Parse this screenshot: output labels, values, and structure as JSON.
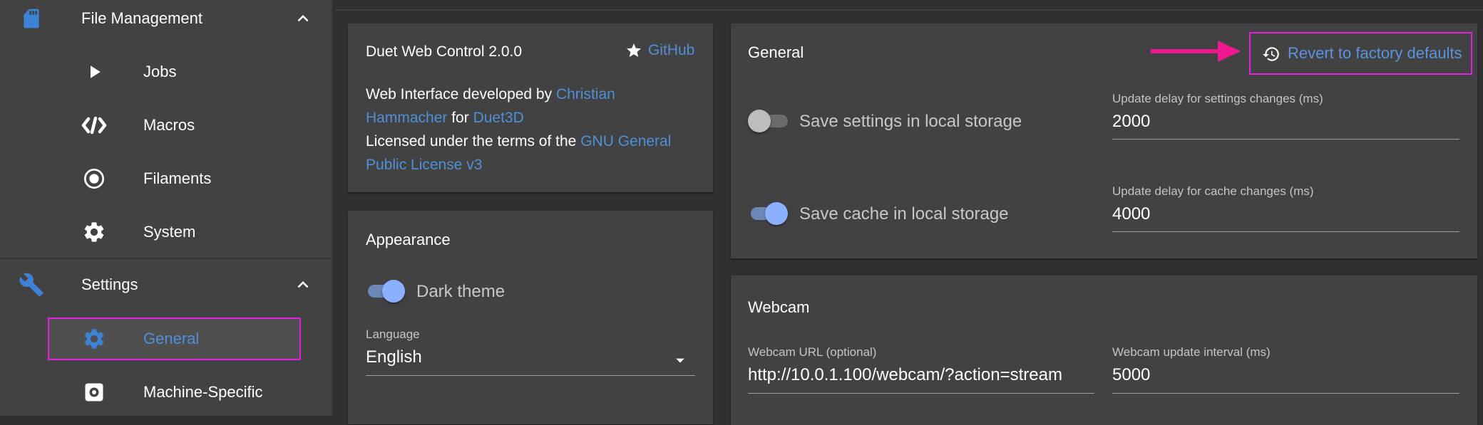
{
  "sidebar": {
    "file_management": {
      "label": "File Management",
      "icon": "sd-card-icon"
    },
    "items_top": [
      {
        "label": "Jobs",
        "icon": "play-icon"
      },
      {
        "label": "Macros",
        "icon": "code-icon"
      },
      {
        "label": "Filaments",
        "icon": "radio-icon"
      },
      {
        "label": "System",
        "icon": "gear-icon"
      }
    ],
    "settings": {
      "label": "Settings",
      "icon": "wrench-icon"
    },
    "items_settings": [
      {
        "label": "General",
        "icon": "gear-icon",
        "active": true
      },
      {
        "label": "Machine-Specific",
        "icon": "gear-box-icon"
      }
    ]
  },
  "about": {
    "title": "Duet Web Control 2.0.0",
    "github_label": "GitHub",
    "dev_prefix": "Web Interface developed by ",
    "dev_name_1": "Christian",
    "dev_name_2": "Hammacher",
    "dev_for": " for ",
    "org": "Duet3D",
    "license_prefix": "Licensed under the terms of the ",
    "license_1": "GNU General",
    "license_2": "Public License v3"
  },
  "appearance": {
    "title": "Appearance",
    "dark_theme_label": "Dark theme",
    "dark_theme_on": true,
    "language_label": "Language",
    "language_value": "English"
  },
  "general": {
    "title": "General",
    "revert_label": "Revert to factory defaults",
    "save_settings_label": "Save settings in local storage",
    "save_settings_on": false,
    "save_cache_label": "Save cache in local storage",
    "save_cache_on": true,
    "settings_delay_label": "Update delay for settings changes (ms)",
    "settings_delay_value": "2000",
    "cache_delay_label": "Update delay for cache changes (ms)",
    "cache_delay_value": "4000"
  },
  "webcam": {
    "title": "Webcam",
    "url_label": "Webcam URL (optional)",
    "url_value": "http://10.0.1.100/webcam/?action=stream",
    "interval_label": "Webcam update interval (ms)",
    "interval_value": "5000"
  },
  "colors": {
    "accent": "#4f8fd8",
    "highlight": "#e51ee0",
    "annotation_arrow": "#f0188f"
  }
}
